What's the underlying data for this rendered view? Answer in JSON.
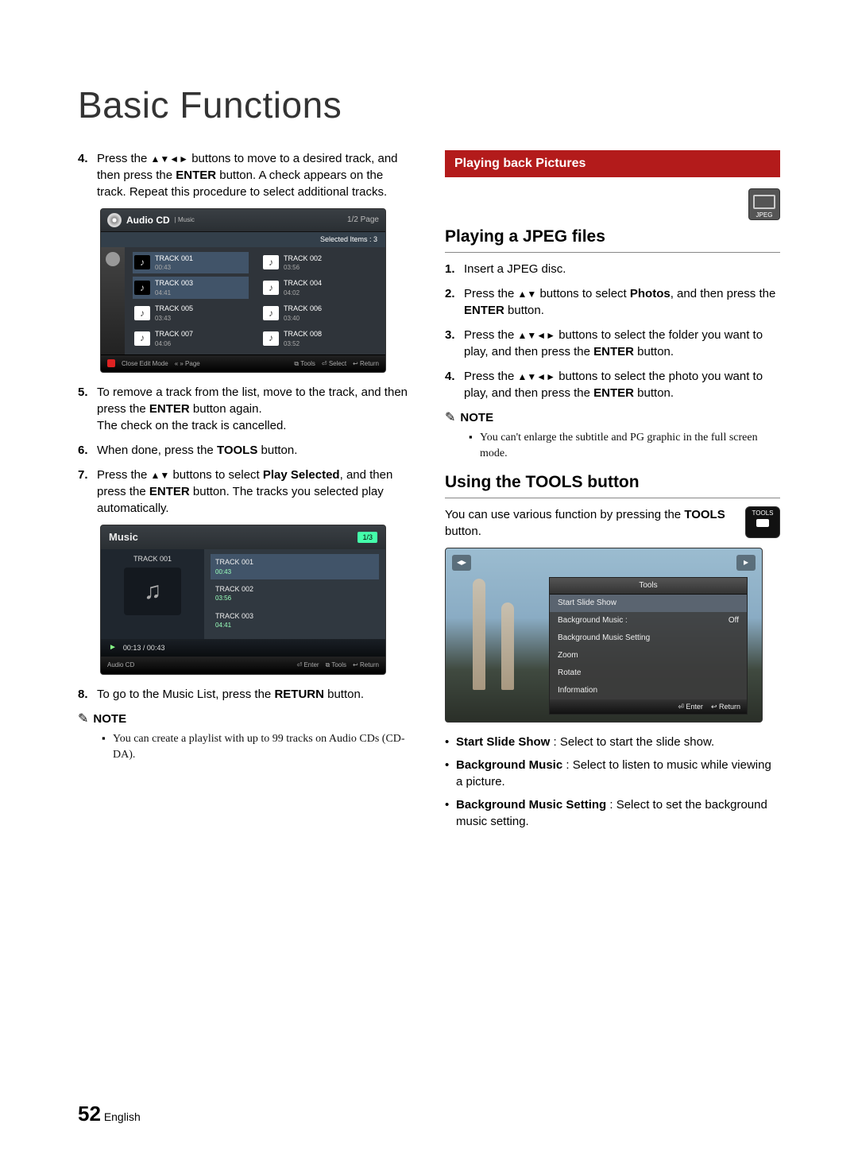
{
  "page": {
    "title": "Basic Functions",
    "number": "52",
    "lang": "English"
  },
  "left": {
    "step4_a": "Press the ",
    "step4_b": " buttons to move to a desired track, and then press the ",
    "step4_enter": "ENTER",
    "step4_c": " button. A check appears on the track. Repeat this procedure to select additional tracks.",
    "step5_a": "To remove a track from the list, move to the track, and then press the ",
    "step5_enter": "ENTER",
    "step5_b": " button again.",
    "step5_c": "The check on the track is cancelled.",
    "step6_a": "When done, press the ",
    "step6_tools": "TOOLS",
    "step6_b": " button.",
    "step7_a": "Press the ",
    "step7_b": " buttons to select ",
    "step7_play": "Play Selected",
    "step7_c": ", and then press the ",
    "step7_enter": "ENTER",
    "step7_d": " button. The tracks you selected play automatically.",
    "step8_a": "To go to the Music List, press the ",
    "step8_return": "RETURN",
    "step8_b": " button.",
    "note_label": "NOTE",
    "note1": "You can create a playlist with up to 99 tracks on Audio CDs (CD-DA)."
  },
  "ss1": {
    "title": "Audio CD",
    "subtitle": "| Music",
    "page": "1/2 Page",
    "selected": "Selected Items : 3",
    "tracks": [
      {
        "n": "TRACK 001",
        "d": "00:43",
        "sel": true
      },
      {
        "n": "TRACK 002",
        "d": "03:56",
        "sel": false
      },
      {
        "n": "TRACK 003",
        "d": "04:41",
        "sel": true
      },
      {
        "n": "TRACK 004",
        "d": "04:02",
        "sel": false
      },
      {
        "n": "TRACK 005",
        "d": "03:43",
        "sel": false
      },
      {
        "n": "TRACK 006",
        "d": "03:40",
        "sel": false
      },
      {
        "n": "TRACK 007",
        "d": "04:06",
        "sel": false
      },
      {
        "n": "TRACK 008",
        "d": "03:52",
        "sel": false
      }
    ],
    "ft_close": "Close Edit Mode",
    "ft_page": "Page",
    "ft_tools": "Tools",
    "ft_select": "Select",
    "ft_return": "Return"
  },
  "ss2": {
    "title": "Music",
    "page": "1/3",
    "now": "TRACK 001",
    "list": [
      {
        "n": "TRACK 001",
        "d": "00:43",
        "sel": true
      },
      {
        "n": "TRACK 002",
        "d": "03:56",
        "sel": false
      },
      {
        "n": "TRACK 003",
        "d": "04:41",
        "sel": false
      }
    ],
    "time": "00:13 / 00:43",
    "ft_src": "Audio CD",
    "ft_enter": "Enter",
    "ft_tools": "Tools",
    "ft_return": "Return"
  },
  "right": {
    "band": "Playing back Pictures",
    "jpeg_badge": "JPEG",
    "h_jpeg": "Playing a JPEG files",
    "s1": "Insert a JPEG disc.",
    "s2_a": "Press the ",
    "s2_b": " buttons to select ",
    "s2_photos": "Photos",
    "s2_c": ", and then press the ",
    "s2_enter": "ENTER",
    "s2_d": " button.",
    "s3_a": "Press the ",
    "s3_b": " buttons to select the folder you want to play, and then press the ",
    "s3_enter": "ENTER",
    "s3_c": " button.",
    "s4_a": "Press the ",
    "s4_b": " buttons to select the photo you want to play, and then press the ",
    "s4_enter": "ENTER",
    "s4_c": " button.",
    "note_label": "NOTE",
    "note1": "You can't enlarge the subtitle and PG graphic in the full screen mode.",
    "h_tools": "Using the TOOLS button",
    "tools_intro_a": "You can use various function by pressing the ",
    "tools_intro_b": "TOOLS",
    "tools_intro_c": " button.",
    "tools_btn": "TOOLS",
    "b1_t": "Start Slide Show",
    "b1_d": " : Select to start the slide show.",
    "b2_t": "Background Music",
    "b2_d": " : Select to listen to music while viewing a picture.",
    "b3_t": "Background Music Setting",
    "b3_d": " : Select to set the background music setting."
  },
  "ss3": {
    "title": "Tools",
    "items": [
      {
        "l": "Start Slide Show",
        "v": ""
      },
      {
        "l": "Background Music",
        "v": "Off",
        "colon": ":"
      },
      {
        "l": "Background Music Setting",
        "v": ""
      },
      {
        "l": "Zoom",
        "v": ""
      },
      {
        "l": "Rotate",
        "v": ""
      },
      {
        "l": "Information",
        "v": ""
      }
    ],
    "ft_enter": "Enter",
    "ft_return": "Return"
  }
}
